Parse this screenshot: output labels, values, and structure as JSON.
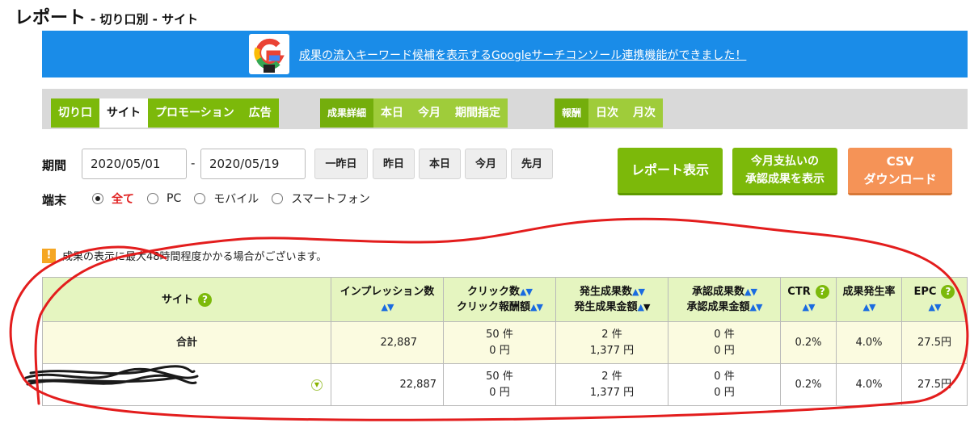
{
  "page": {
    "title": "レポート",
    "subtitle": "- 切り口別 - サイト"
  },
  "banner": {
    "text": "成果の流入キーワード候補を表示するGoogleサーチコンソール連携機能ができました！",
    "logo_letter": "G"
  },
  "tabs": {
    "group1": [
      "切り口",
      "サイト",
      "プロモーション",
      "広告"
    ],
    "group2": [
      "成果詳細",
      "本日",
      "今月",
      "期間指定"
    ],
    "group3": [
      "報酬",
      "日次",
      "月次"
    ]
  },
  "filters": {
    "period_label": "期間",
    "start_date": "2020/05/01",
    "separator": "-",
    "end_date": "2020/05/19",
    "quick_buttons": [
      "一昨日",
      "昨日",
      "本日",
      "今月",
      "先月"
    ],
    "device_label": "端末",
    "device_options": [
      "全て",
      "PC",
      "モバイル",
      "スマートフォン"
    ],
    "device_selected": "全て"
  },
  "actions": {
    "report": "レポート表示",
    "approved": "今月支払いの\n承認成果を表示",
    "csv": "CSV\nダウンロード"
  },
  "notice": {
    "icon": "!",
    "text": "成果の表示に最大48時間程度かかる場合がございます。"
  },
  "table": {
    "headers": {
      "site": "サイト",
      "impressions": "インプレッション数",
      "clicks": "クリック数",
      "click_reward": "クリック報酬額",
      "occurred": "発生成果数",
      "occurred_amount": "発生成果金額",
      "approved": "承認成果数",
      "approved_amount": "承認成果金額",
      "ctr": "CTR",
      "rate": "成果発生率",
      "epc": "EPC"
    },
    "total": {
      "label": "合計",
      "impressions": "22,887",
      "clicks": "50 件",
      "click_reward": "0 円",
      "occurred": "2 件",
      "occurred_amount": "1,377 円",
      "approved": "0 件",
      "approved_amount": "0 円",
      "ctr": "0.2%",
      "rate": "4.0%",
      "epc": "27.5円"
    },
    "rows": [
      {
        "impressions": "22,887",
        "clicks": "50 件",
        "click_reward": "0 円",
        "occurred": "2 件",
        "occurred_amount": "1,377 円",
        "approved": "0 件",
        "approved_amount": "0 円",
        "ctr": "0.2%",
        "rate": "4.0%",
        "epc": "27.5円"
      }
    ]
  },
  "colors": {
    "accent_green": "#7cb90a",
    "banner_blue": "#1a8ce8",
    "csv_orange": "#f59357",
    "annotation_red": "#e31d1d"
  }
}
